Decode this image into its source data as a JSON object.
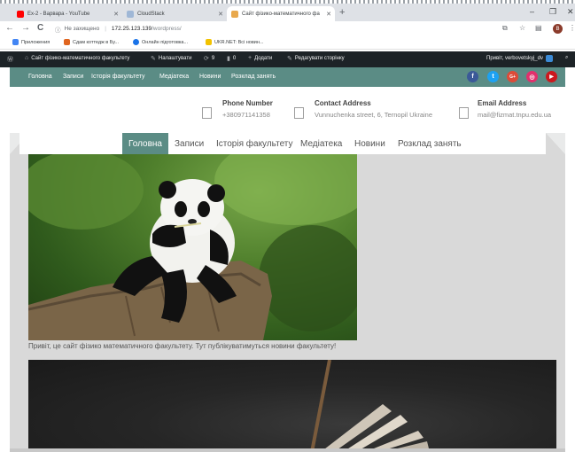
{
  "browser": {
    "tabs": [
      {
        "title": "Ex-2 - Варвара - YouTube",
        "color": "#ff0000"
      },
      {
        "title": "CloudStack",
        "color": "#9fb7d6"
      },
      {
        "title": "Сайт фізико-математичного фа",
        "color": "#e8a84c"
      }
    ],
    "new_tab": "+",
    "window_controls": {
      "minimize": "–",
      "restore": "❐",
      "close": "✕"
    },
    "nav": {
      "back": "←",
      "forward": "→",
      "reload": "C"
    },
    "address": {
      "security": "Не захищено",
      "host": "172.25.123.139",
      "path": "/wordpress/"
    },
    "avatar_letter": "B",
    "bookmarks": [
      {
        "label": "Приложения",
        "color": "#4285f4"
      },
      {
        "label": "Сдам коттедж в Бу...",
        "color": "#e0651f"
      },
      {
        "label": "Онлайн підготовка...",
        "color": "#1a73e8"
      },
      {
        "label": "UKR.NET: Всі новин...",
        "color": "#f2c200"
      }
    ]
  },
  "adminbar": {
    "site": "Сайт фізико-математичного факультету",
    "customize": "Налаштувати",
    "updates": "9",
    "comments": "0",
    "new": "Додати",
    "edit": "Редагувати сторінку",
    "greeting": "Привіт, verbovetskyj_dv"
  },
  "topnav": [
    "Головна",
    "Записи",
    "Історія факультету",
    "Медіатека",
    "Новини",
    "Розклад занять"
  ],
  "social": [
    {
      "name": "facebook",
      "glyph": "f",
      "color": "#3b5998"
    },
    {
      "name": "twitter",
      "glyph": "t",
      "color": "#1da1f2"
    },
    {
      "name": "google",
      "glyph": "G+",
      "color": "#dd4b39"
    },
    {
      "name": "instagram",
      "glyph": "◎",
      "color": "#e1306c"
    },
    {
      "name": "youtube",
      "glyph": "▶",
      "color": "#cc181e"
    }
  ],
  "contacts": {
    "phone": {
      "title": "Phone Number",
      "value": "+380971141358"
    },
    "address": {
      "title": "Contact Address",
      "value": "Vunnuchenka street, 6, Ternopil Ukraine"
    },
    "email": {
      "title": "Email Address",
      "value": "mail@fizmat.tnpu.edu.ua"
    }
  },
  "mainnav": [
    "Головна",
    "Записи",
    "Історія факультету",
    "Медіатека",
    "Новини",
    "Розклад занять"
  ],
  "caption": "Привіт, це сайт фізико математичного факультету. Тут публікуватимуться новини факультету!"
}
